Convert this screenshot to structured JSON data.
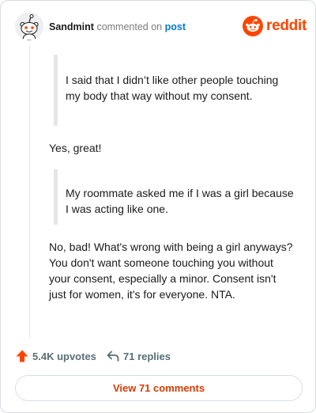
{
  "comment": {
    "username": "Sandmint",
    "action_text": "commented on",
    "post_link_text": "post",
    "quote_1": "I said that I didn’t like other people touching my body that way without my consent.",
    "reply_1": "Yes, great!",
    "quote_2": "My roommate asked me if I was a girl because I was acting like one.",
    "reply_2": "No, bad! What's wrong with being a girl anyways? You don't want someone touching you without your consent, especially a minor. Consent isn't just for women, it's for everyone. NTA."
  },
  "brand": {
    "wordmark": "reddit",
    "color": "#ff4500",
    "icon": "reddit-snoo-icon"
  },
  "stats": {
    "upvotes": "5.4K upvotes",
    "upvote_icon": "upvote-arrow-icon",
    "replies": "71 replies",
    "reply_icon": "reply-arrow-icon"
  },
  "view_comments_label": "View 71 comments",
  "colors": {
    "link_blue": "#0079d3",
    "upvote_orange": "#ff4500",
    "cta_orange": "#d93a00",
    "muted_text": "#576f76"
  }
}
